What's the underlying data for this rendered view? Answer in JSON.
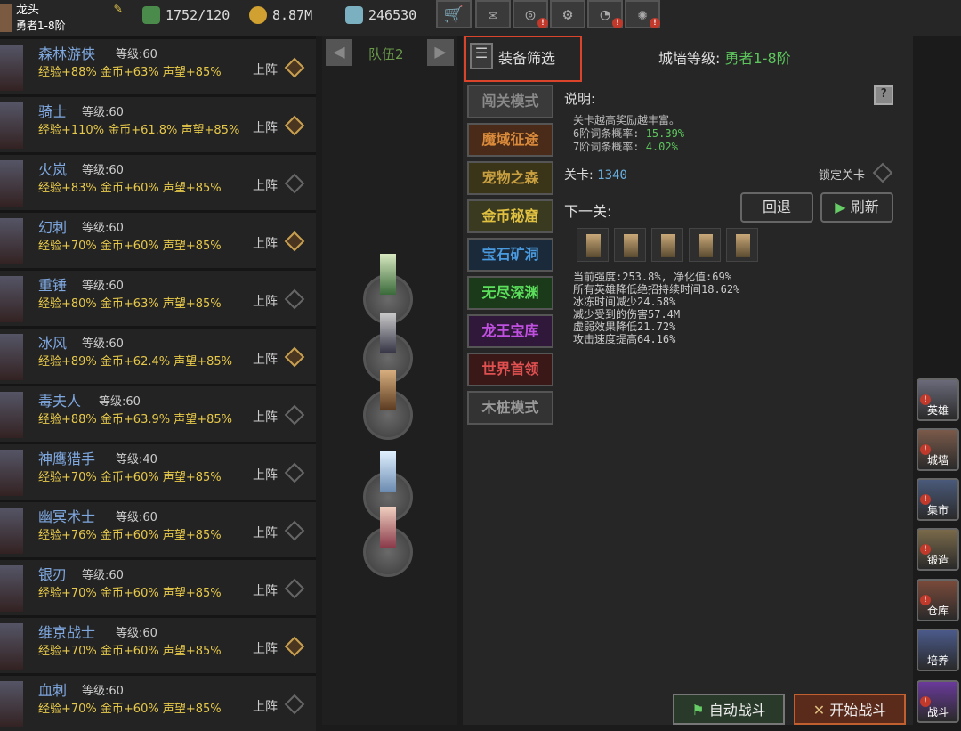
{
  "player": {
    "name": "龙头",
    "rank": "勇者1-8阶"
  },
  "resources": {
    "stamina": "1752/120",
    "gold": "8.87M",
    "gems": "246530"
  },
  "toolbar": [
    "shop-cart-icon",
    "mail-icon",
    "gamepad-icon",
    "gear-icon",
    "pie-icon",
    "firework-icon"
  ],
  "heroes": [
    {
      "name": "森林游侠",
      "level": "等级:60",
      "stats": "经验+88%  金币+63%  声望+85%",
      "btn": "上阵",
      "on": true
    },
    {
      "name": "骑士",
      "level": "等级:60",
      "stats": "经验+110%  金币+61.8%  声望+85%",
      "btn": "上阵",
      "on": true
    },
    {
      "name": "火岚",
      "level": "等级:60",
      "stats": "经验+83%  金币+60%  声望+85%",
      "btn": "上阵",
      "on": false
    },
    {
      "name": "幻刺",
      "level": "等级:60",
      "stats": "经验+70%  金币+60%  声望+85%",
      "btn": "上阵",
      "on": true
    },
    {
      "name": "重锤",
      "level": "等级:60",
      "stats": "经验+80%  金币+63%  声望+85%",
      "btn": "上阵",
      "on": false
    },
    {
      "name": "冰风",
      "level": "等级:60",
      "stats": "经验+89%  金币+62.4%  声望+85%",
      "btn": "上阵",
      "on": true
    },
    {
      "name": "毒夫人",
      "level": "等级:60",
      "stats": "经验+88%  金币+63.9%  声望+85%",
      "btn": "上阵",
      "on": false
    },
    {
      "name": "神鹰猎手",
      "level": "等级:40",
      "stats": "经验+70%  金币+60%  声望+85%",
      "btn": "上阵",
      "on": false
    },
    {
      "name": "幽冥术士",
      "level": "等级:60",
      "stats": "经验+76%  金币+60%  声望+85%",
      "btn": "上阵",
      "on": false
    },
    {
      "name": "银刃",
      "level": "等级:60",
      "stats": "经验+70%  金币+60%  声望+85%",
      "btn": "上阵",
      "on": false
    },
    {
      "name": "维京战士",
      "level": "等级:60",
      "stats": "经验+70%  金币+60%  声望+85%",
      "btn": "上阵",
      "on": true
    },
    {
      "name": "血刺",
      "level": "等级:60",
      "stats": "经验+70%  金币+60%  声望+85%",
      "btn": "上阵",
      "on": false
    }
  ],
  "team": {
    "name": "队伍2"
  },
  "filter": {
    "label": "装备筛选"
  },
  "wall": {
    "label": "城墙等级:",
    "value": "勇者1-8阶"
  },
  "modes": [
    {
      "label": "闯关模式",
      "color": "#8a8a8a",
      "bg": "#3a3a3a"
    },
    {
      "label": "魔域征途",
      "color": "#d98a3a",
      "bg": "#4a2a18"
    },
    {
      "label": "宠物之森",
      "color": "#c9a040",
      "bg": "#3a3418"
    },
    {
      "label": "金币秘窟",
      "color": "#e0c040",
      "bg": "#3a3a20"
    },
    {
      "label": "宝石矿洞",
      "color": "#4a9ae0",
      "bg": "#1a2a3a"
    },
    {
      "label": "无尽深渊",
      "color": "#5ce05c",
      "bg": "#1a3a1a"
    },
    {
      "label": "龙王宝库",
      "color": "#c050e0",
      "bg": "#30183a"
    },
    {
      "label": "世界首领",
      "color": "#e05050",
      "bg": "#3a1818"
    },
    {
      "label": "木桩模式",
      "color": "#9a9a9a",
      "bg": "#333"
    }
  ],
  "desc": {
    "title": "说明:",
    "line1": "关卡越高奖励越丰富。",
    "line2a": "6阶词条概率: ",
    "line2b": "15.39%",
    "line3a": "7阶词条概率: ",
    "line3b": "4.02%"
  },
  "stage": {
    "label": "关卡:",
    "value": "1340",
    "lock": "锁定关卡"
  },
  "next": {
    "label": "下一关:",
    "back": "回退",
    "refresh": "刷新"
  },
  "stats": [
    "当前强度:253.8%, 净化值:69%",
    "所有英雄降低绝招持续时间18.62%",
    "冰冻时间减少24.58%",
    "减少受到的伤害57.4M",
    "虚弱效果降低21.72%",
    "攻击速度提高64.16%"
  ],
  "side": [
    {
      "label": "英雄"
    },
    {
      "label": "城墙"
    },
    {
      "label": "集市"
    },
    {
      "label": "锻造"
    },
    {
      "label": "仓库"
    },
    {
      "label": "培养"
    },
    {
      "label": "战斗"
    }
  ],
  "fight": {
    "auto": "自动战斗",
    "start": "开始战斗"
  }
}
